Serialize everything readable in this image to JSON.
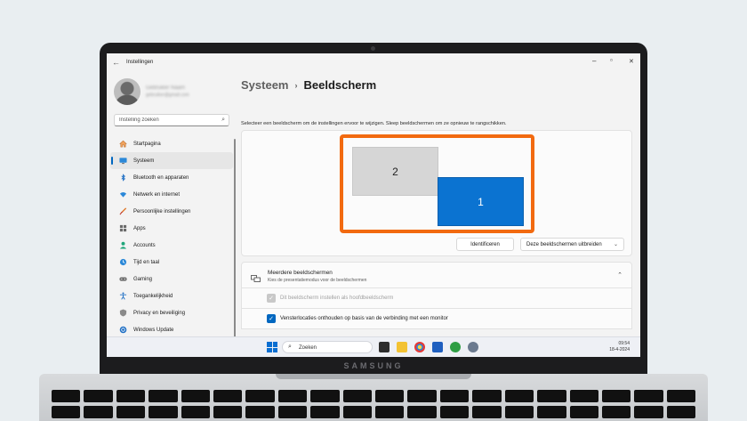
{
  "window": {
    "app_title": "Instellingen",
    "minimize_glyph": "–",
    "maximize_glyph": "▫",
    "close_glyph": "✕"
  },
  "profile": {
    "name": "Gebruiker Naam",
    "email": "gebruiker@gmail.com"
  },
  "search": {
    "placeholder": "Instelling zoeken"
  },
  "sidebar": {
    "items": [
      {
        "label": "Startpagina",
        "icon": "home-icon",
        "active": false
      },
      {
        "label": "Systeem",
        "icon": "monitor-icon",
        "active": true
      },
      {
        "label": "Bluetooth en apparaten",
        "icon": "bluetooth-icon",
        "active": false
      },
      {
        "label": "Netwerk en internet",
        "icon": "wifi-icon",
        "active": false
      },
      {
        "label": "Persoonlijke instellingen",
        "icon": "brush-icon",
        "active": false
      },
      {
        "label": "Apps",
        "icon": "apps-icon",
        "active": false
      },
      {
        "label": "Accounts",
        "icon": "person-icon",
        "active": false
      },
      {
        "label": "Tijd en taal",
        "icon": "globe-clock-icon",
        "active": false
      },
      {
        "label": "Gaming",
        "icon": "gamepad-icon",
        "active": false
      },
      {
        "label": "Toegankelijkheid",
        "icon": "accessibility-icon",
        "active": false
      },
      {
        "label": "Privacy en beveiliging",
        "icon": "shield-icon",
        "active": false
      },
      {
        "label": "Windows Update",
        "icon": "sync-icon",
        "active": false
      }
    ]
  },
  "breadcrumb": {
    "parent": "Systeem",
    "separator": "›",
    "current": "Beeldscherm"
  },
  "display_arrangement": {
    "hint": "Selecteer een beeldscherm om de instellingen ervoor te wijzigen. Sleep beeldschermen om ze opnieuw te rangschikken.",
    "monitors": [
      {
        "number": "2",
        "selected": false
      },
      {
        "number": "1",
        "selected": true
      }
    ],
    "identify_label": "Identificeren",
    "mode_value": "Deze beeldschermen uitbreiden"
  },
  "multiple_displays": {
    "title": "Meerdere beeldschermen",
    "subtitle": "Kies de presentatiemodus voor de beeldschermen",
    "options": [
      {
        "label": "Dit beeldscherm instellen als hoofdbeeldscherm",
        "checked": true,
        "disabled": true
      },
      {
        "label": "Vensterlocaties onthouden op basis van de verbinding met een monitor",
        "checked": true,
        "disabled": false
      }
    ]
  },
  "taskbar": {
    "search_label": "Zoeken",
    "time": "09:54",
    "date": "18-4-2024"
  },
  "device": {
    "brand": "SAMSUNG"
  },
  "colors": {
    "accent": "#0067c0",
    "highlight_frame": "#f26a10",
    "selected_monitor": "#0b73d1"
  }
}
